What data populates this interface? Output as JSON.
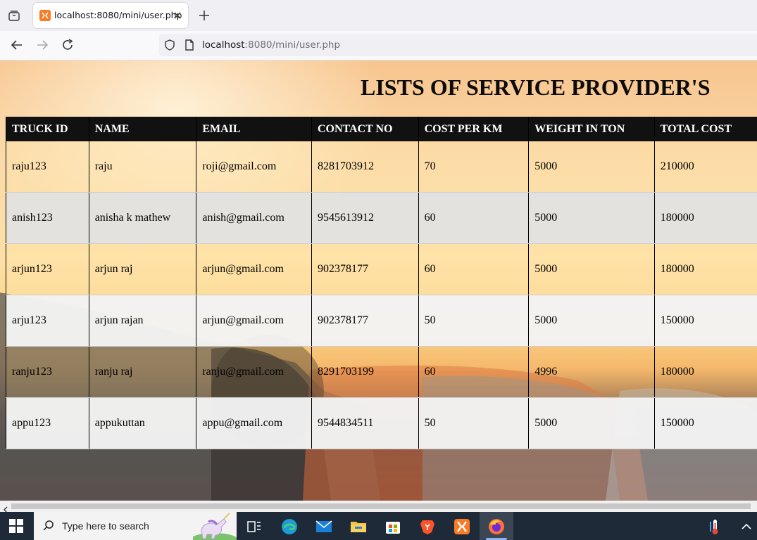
{
  "browser": {
    "tab_title": "localhost:8080/mini/user.php",
    "url_host": "localhost",
    "url_rest": ":8080/mini/user.php"
  },
  "page": {
    "title": "LISTS OF SERVICE PROVIDER'S",
    "table": {
      "headers": [
        "TRUCK ID",
        "NAME",
        "EMAIL",
        "CONTACT NO",
        "COST PER KM",
        "WEIGHT IN TON",
        "TOTAL COST"
      ],
      "rows": [
        [
          "raju123",
          "raju",
          "roji@gmail.com",
          "8281703912",
          "70",
          "5000",
          "210000"
        ],
        [
          "anish123",
          "anisha k mathew",
          "anish@gmail.com",
          "9545613912",
          "60",
          "5000",
          "180000"
        ],
        [
          "arjun123",
          "arjun raj",
          "arjun@gmail.com",
          "902378177",
          "60",
          "5000",
          "180000"
        ],
        [
          "arju123",
          "arjun rajan",
          "arjun@gmail.com",
          "902378177",
          "50",
          "5000",
          "150000"
        ],
        [
          "ranju123",
          "ranju raj",
          "ranju@gmail.com",
          "8291703199",
          "60",
          "4996",
          "180000"
        ],
        [
          "appu123",
          "appukuttan",
          "appu@gmail.com",
          "9544834511",
          "50",
          "5000",
          "150000"
        ]
      ]
    }
  },
  "taskbar": {
    "search_placeholder": "Type here to search",
    "icons": [
      "windows-start-icon",
      "task-view-icon",
      "edge-icon",
      "mail-icon",
      "file-explorer-icon",
      "microsoft-store-icon",
      "brave-icon",
      "xampp-icon",
      "firefox-icon",
      "thermometer-icon",
      "chevron-up-icon"
    ]
  }
}
